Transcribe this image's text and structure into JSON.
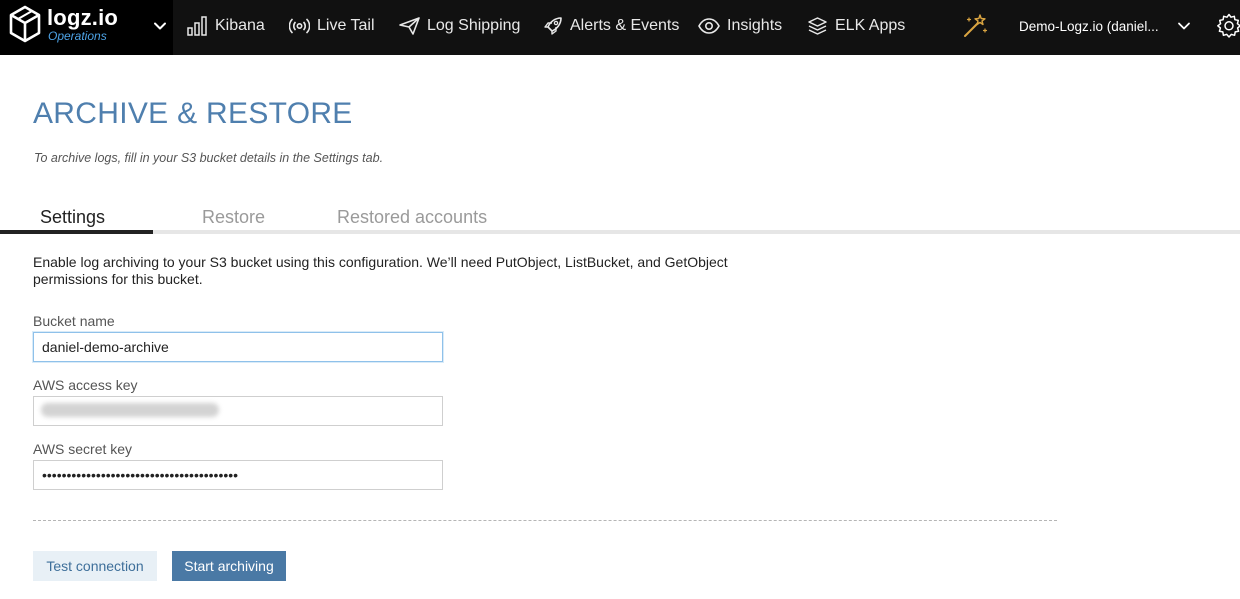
{
  "brand": {
    "name": "logz.io",
    "subtitle": "Operations",
    "icon": "cube-logo-icon",
    "accent_color": "#4da3e6"
  },
  "nav": {
    "items": [
      {
        "label": "Kibana",
        "icon": "bar-chart-icon"
      },
      {
        "label": "Live Tail",
        "icon": "broadcast-icon"
      },
      {
        "label": "Log Shipping",
        "icon": "paper-plane-icon"
      },
      {
        "label": "Alerts & Events",
        "icon": "rocket-icon"
      },
      {
        "label": "Insights",
        "icon": "eye-icon"
      },
      {
        "label": "ELK Apps",
        "icon": "layers-icon"
      }
    ],
    "account_label": "Demo-Logz.io (daniel...",
    "wand_icon": "magic-wand-icon",
    "settings_icon": "gear-icon"
  },
  "page": {
    "title": "ARCHIVE & RESTORE",
    "subtitle": "To archive logs, fill in your S3 bucket details in the Settings tab.",
    "title_color": "#4f7fae"
  },
  "tabs": [
    {
      "label": "Settings",
      "active": true
    },
    {
      "label": "Restore",
      "active": false
    },
    {
      "label": "Restored accounts",
      "active": false
    }
  ],
  "form": {
    "intro": "Enable log archiving to your S3 bucket using this configuration. We’ll need PutObject, ListBucket, and GetObject permissions for this bucket.",
    "bucket_label": "Bucket name",
    "bucket_value": "daniel-demo-archive",
    "access_key_label": "AWS access key",
    "secret_key_label": "AWS secret key",
    "secret_key_value": "••••••••••••••••••••••••••••••••••••••••"
  },
  "actions": {
    "test_label": "Test connection",
    "start_label": "Start archiving",
    "primary_color": "#4a79a5"
  }
}
